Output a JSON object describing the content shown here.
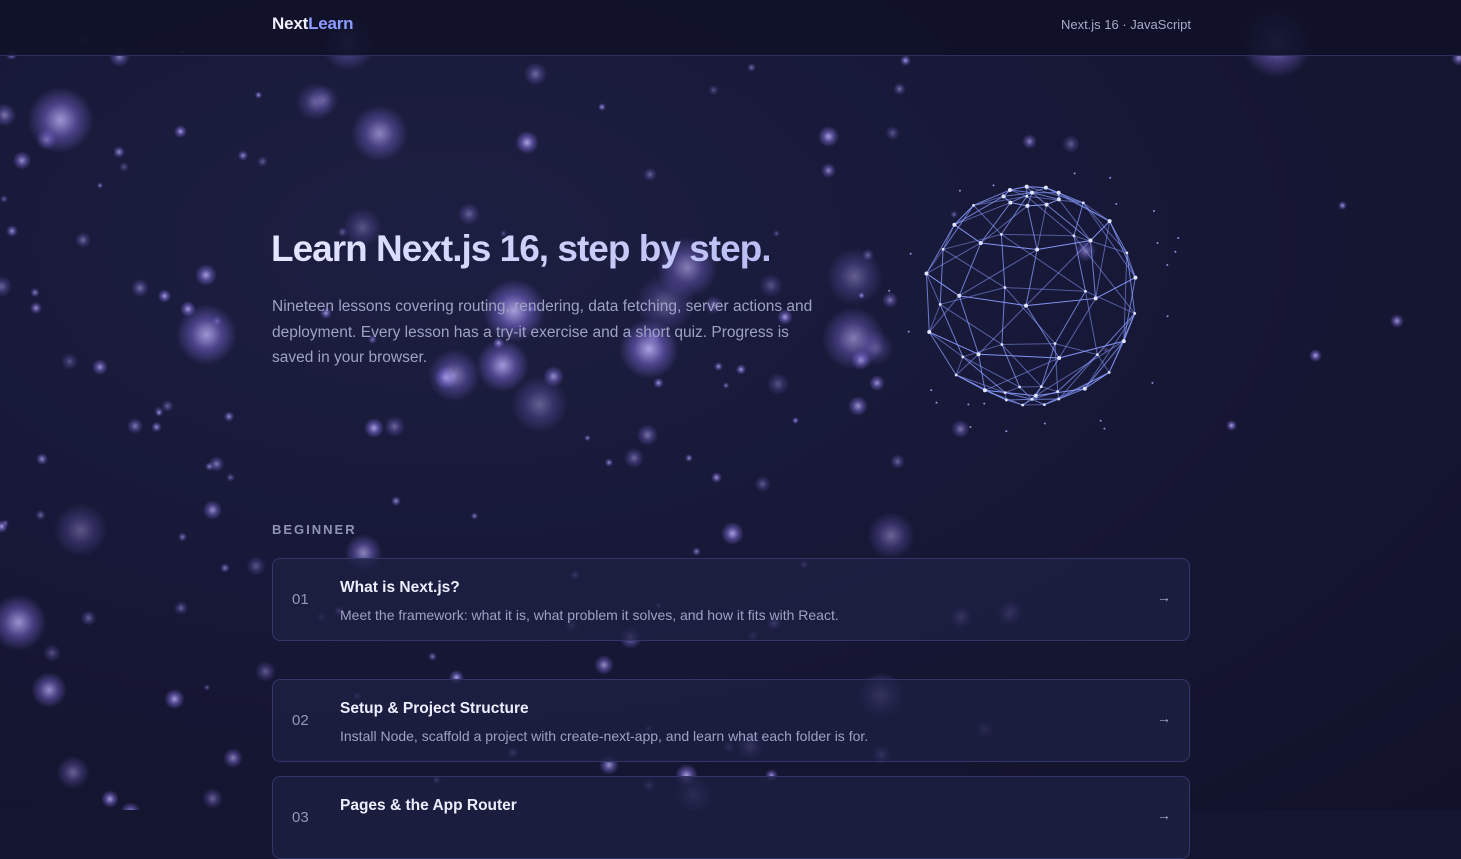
{
  "header": {
    "logo_part1": "Next",
    "logo_part2": "Learn",
    "tech": "Next.js 16 · JavaScript"
  },
  "hero": {
    "title": "Learn Next.js 16, step by step.",
    "description": "Nineteen lessons covering routing, rendering, data fetching, server actions and deployment. Every lesson has a try-it exercise and a short quiz. Progress is saved in your browser."
  },
  "section": {
    "label": "BEGINNER"
  },
  "lessons": [
    {
      "num": "01",
      "title": "What is Next.js?",
      "desc": "Meet the framework: what it is, what problem it solves, and how it fits with React."
    },
    {
      "num": "02",
      "title": "Setup & Project Structure",
      "desc": "Install Node, scaffold a project with create-next-app, and learn what each folder is for."
    },
    {
      "num": "03",
      "title": "Pages & the App Router",
      "desc": ""
    }
  ],
  "icons": {
    "arrow": "→",
    "arrow_name": "arrow-right-icon",
    "globe_name": "wireframe-globe"
  },
  "colors": {
    "background": "#14152f",
    "accent": "#8c9bff",
    "card": "#1e2042",
    "orb": "#9d8cff"
  }
}
